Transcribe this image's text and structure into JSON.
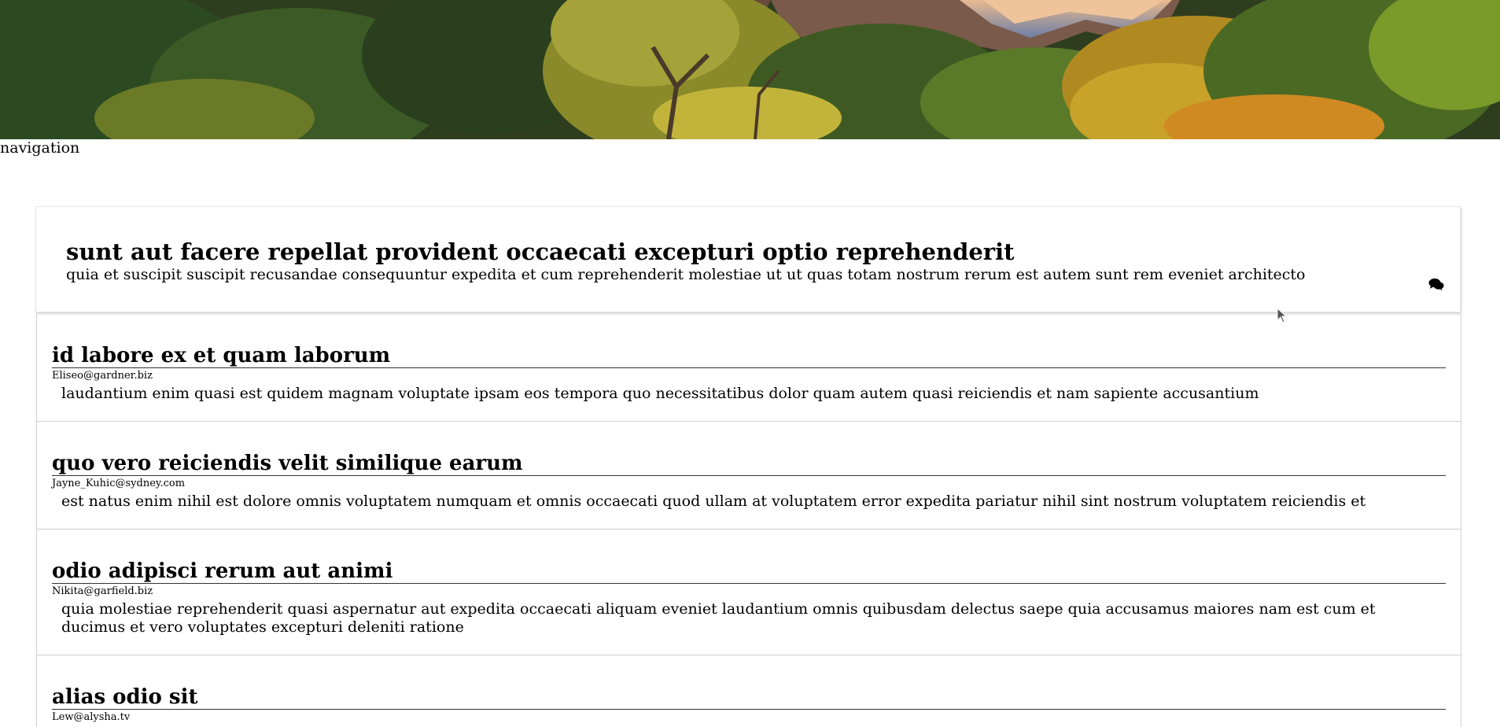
{
  "banner": {
    "alt": "Canyon landscape with autumn trees"
  },
  "navigation": {
    "label": "navigation"
  },
  "post": {
    "title": "sunt aut facere repellat provident occaecati excepturi optio reprehenderit",
    "body": "quia et suscipit suscipit recusandae consequuntur expedita et cum reprehenderit molestiae ut ut quas totam nostrum rerum est autem sunt rem eveniet architecto",
    "comments_icon": "comments-icon"
  },
  "comments": [
    {
      "name": "id labore ex et quam laborum",
      "email": "Eliseo@gardner.biz",
      "body": "laudantium enim quasi est quidem magnam voluptate ipsam eos tempora quo necessitatibus dolor quam autem quasi reiciendis et nam sapiente accusantium"
    },
    {
      "name": "quo vero reiciendis velit similique earum",
      "email": "Jayne_Kuhic@sydney.com",
      "body": "est natus enim nihil est dolore omnis voluptatem numquam et omnis occaecati quod ullam at voluptatem error expedita pariatur nihil sint nostrum voluptatem reiciendis et"
    },
    {
      "name": "odio adipisci rerum aut animi",
      "email": "Nikita@garfield.biz",
      "body": "quia molestiae reprehenderit quasi aspernatur aut expedita occaecati aliquam eveniet laudantium omnis quibusdam delectus saepe quia accusamus maiores nam est cum et ducimus et vero voluptates excepturi deleniti ratione"
    },
    {
      "name": "alias odio sit",
      "email": "Lew@alysha.tv",
      "body": ""
    }
  ]
}
